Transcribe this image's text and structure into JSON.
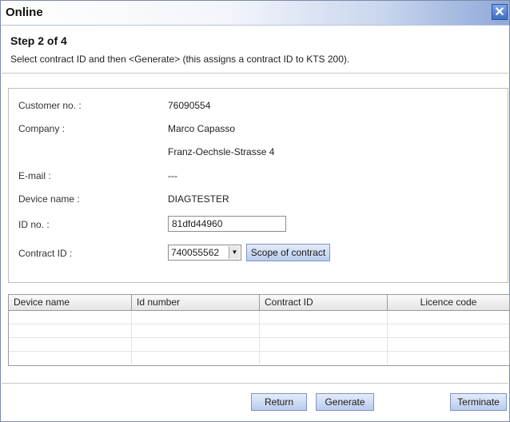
{
  "window": {
    "title": "Online",
    "close_symbol": "✕"
  },
  "step": {
    "title": "Step 2 of 4",
    "description": "Select contract ID and then <Generate> (this assigns a contract ID to KTS 200)."
  },
  "form": {
    "customer_no_label": "Customer no. :",
    "customer_no_value": "76090554",
    "company_label": "Company :",
    "company_value": "Marco Capasso",
    "company_address": "Franz-Oechsle-Strasse 4",
    "email_label": "E-mail :",
    "email_value": "---",
    "device_name_label": "Device name :",
    "device_name_value": "DIAGTESTER",
    "id_no_label": "ID no. :",
    "id_no_value": "81dfd44960",
    "contract_id_label": "Contract ID :",
    "contract_id_selected": "740055562",
    "scope_button": "Scope of contract"
  },
  "table": {
    "columns": [
      "Device name",
      "Id number",
      "Contract ID",
      "Licence code"
    ],
    "rows": [
      [
        "",
        "",
        "",
        ""
      ],
      [
        "",
        "",
        "",
        ""
      ],
      [
        "",
        "",
        "",
        ""
      ],
      [
        "",
        "",
        "",
        ""
      ]
    ]
  },
  "footer": {
    "return_button": "Return",
    "generate_button": "Generate",
    "terminate_button": "Terminate"
  },
  "icons": {
    "close": "close-icon",
    "dropdown": "chevron-down-icon"
  },
  "colors": {
    "button_border": "#7d95c2",
    "title_gradient_end": "#8ea8d8"
  }
}
